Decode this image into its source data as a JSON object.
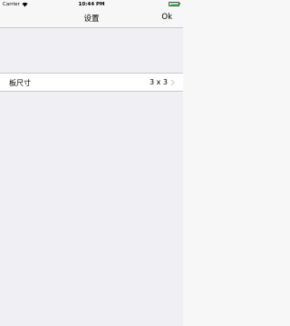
{
  "status_bar": {
    "carrier": "Carrier",
    "time": "10:44 PM",
    "battery_color": "#4cd964"
  },
  "nav": {
    "title": "设置",
    "ok_label": "Ok"
  },
  "settings": {
    "rows": [
      {
        "label": "板尺寸",
        "value": "3 x 3",
        "icon": "chevron-right-icon"
      }
    ]
  }
}
